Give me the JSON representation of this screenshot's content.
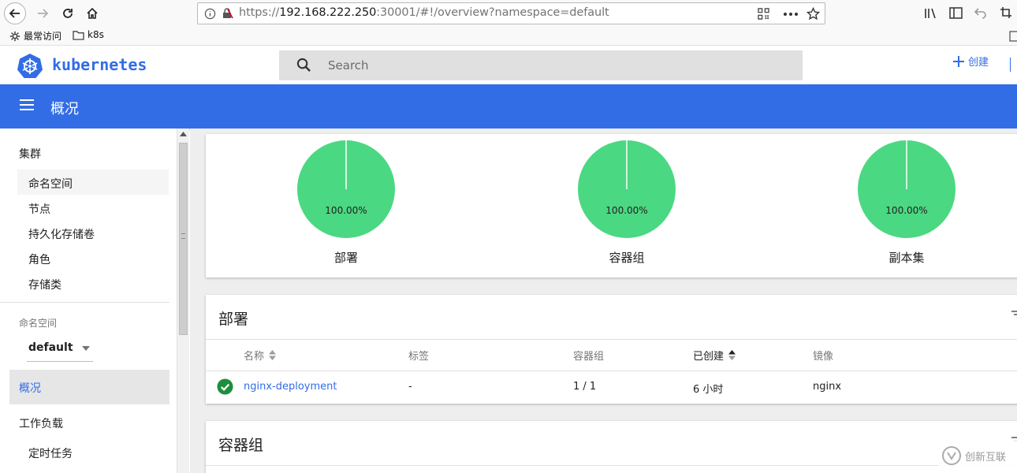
{
  "browser": {
    "url_prefix": "https://",
    "url_host": "192.168.222.250",
    "url_rest": ":30001/#!/overview?namespace=default",
    "bookmarks": [
      "最常访问",
      "k8s"
    ]
  },
  "header": {
    "logo": "kubernetes",
    "search_placeholder": "Search",
    "create_label": "创建"
  },
  "title_bar": {
    "title": "概况"
  },
  "sidebar": {
    "cluster_heading": "集群",
    "cluster_items": [
      "命名空间",
      "节点",
      "持久化存储卷",
      "角色",
      "存储类"
    ],
    "namespace_label": "命名空间",
    "namespace_value": "default",
    "overview": "概况",
    "workloads_heading": "工作负载",
    "workload_items": [
      "定时任务"
    ]
  },
  "status": {
    "charts": [
      {
        "label": "部署",
        "percent": "100.00%",
        "value": 100
      },
      {
        "label": "容器组",
        "percent": "100.00%",
        "value": 100
      },
      {
        "label": "副本集",
        "percent": "100.00%",
        "value": 100
      }
    ],
    "color": "#4bd882"
  },
  "deployments": {
    "title": "部署",
    "columns": {
      "name": "名称",
      "labels": "标签",
      "pods": "容器组",
      "created": "已创建",
      "images": "镜像"
    },
    "rows": [
      {
        "name": "nginx-deployment",
        "labels": "-",
        "pods": "1 / 1",
        "created": "6 小时",
        "images": "nginx"
      }
    ]
  },
  "pods": {
    "title": "容器组"
  },
  "watermark": "创新互联",
  "colors": {
    "brand": "#326de6",
    "ok": "#1e8e3e"
  }
}
